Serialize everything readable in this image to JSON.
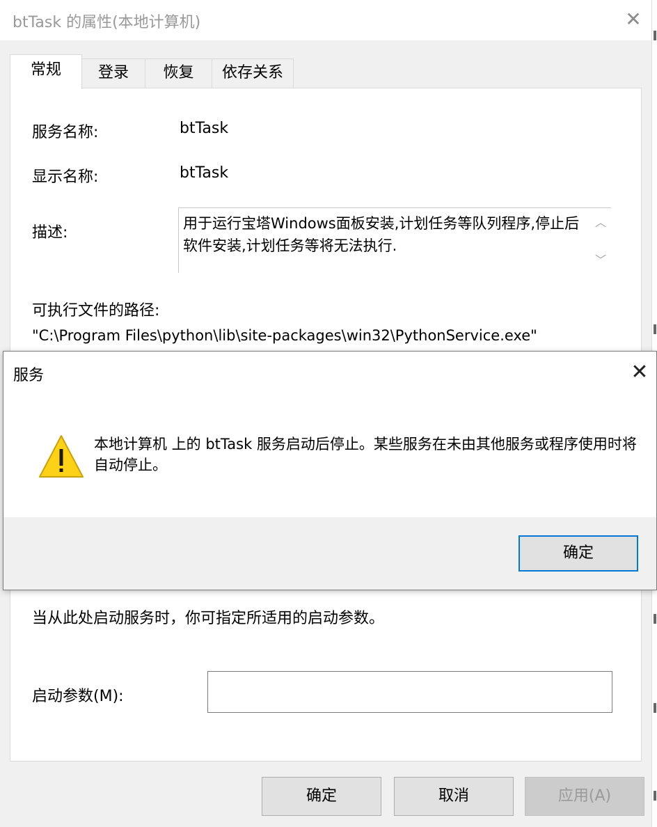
{
  "window": {
    "title": "btTask 的属性(本地计算机)",
    "close_glyph": "✕"
  },
  "tabs": [
    {
      "label": "常规",
      "active": true
    },
    {
      "label": "登录",
      "active": false
    },
    {
      "label": "恢复",
      "active": false
    },
    {
      "label": "依存关系",
      "active": false
    }
  ],
  "general": {
    "service_name_label": "服务名称:",
    "service_name_value": "btTask",
    "display_name_label": "显示名称:",
    "display_name_value": "btTask",
    "description_label": "描述:",
    "description_value": "用于运行宝塔Windows面板安装,计划任务等队列程序,停止后软件安装,计划任务等将无法执行.",
    "exe_path_label": "可执行文件的路径:",
    "exe_path_value": "\"C:\\Program Files\\python\\lib\\site-packages\\win32\\PythonService.exe\"",
    "start_hint": "当从此处启动服务时，你可指定所适用的启动参数。",
    "start_params_label": "启动参数(M):",
    "start_params_value": ""
  },
  "buttons": {
    "ok": "确定",
    "cancel": "取消",
    "apply": "应用(A)"
  },
  "dialog": {
    "title": "服务",
    "close_glyph": "✕",
    "icon": "warning-icon",
    "message": "本地计算机 上的 btTask 服务启动后停止。某些服务在未由其他服务或程序使用时将自动停止。",
    "ok": "确定"
  },
  "colors": {
    "accent": "#0078d7",
    "warning_fill": "#fcd116",
    "dialog_background": "#f0f0f0"
  }
}
